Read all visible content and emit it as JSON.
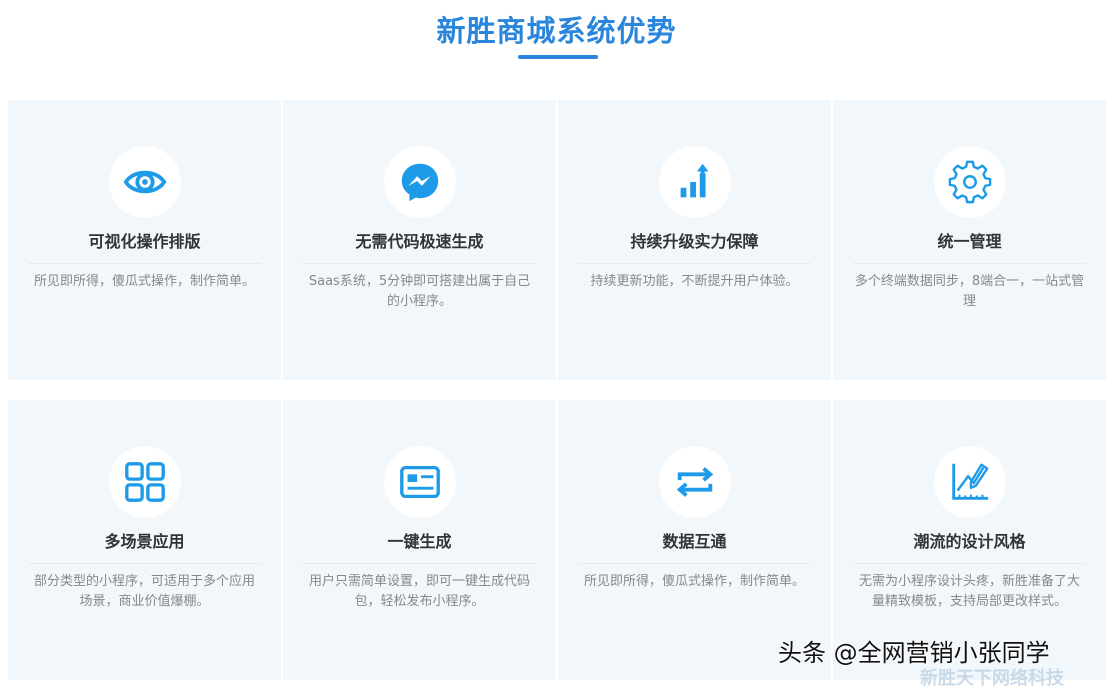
{
  "header": {
    "title": "新胜商城系统优势"
  },
  "accent_color": "#2a86dc",
  "icon_color": "#1e9be8",
  "cards": [
    {
      "icon": "eye-icon",
      "title": "可视化操作排版",
      "desc": "所见即所得，傻瓜式操作，制作简单。"
    },
    {
      "icon": "messenger-icon",
      "title": "无需代码极速生成",
      "desc": "Saas系统，5分钟即可搭建出属于自己的小程序。"
    },
    {
      "icon": "bar-chart-up-icon",
      "title": "持续升级实力保障",
      "desc": "持续更新功能，不断提升用户体验。"
    },
    {
      "icon": "gear-icon",
      "title": "统一管理",
      "desc": "多个终端数据同步，8端合一，一站式管理"
    },
    {
      "icon": "grid-apps-icon",
      "title": "多场景应用",
      "desc": "部分类型的小程序，可适用于多个应用场景，商业价值爆棚。"
    },
    {
      "icon": "id-card-icon",
      "title": "一键生成",
      "desc": "用户只需简单设置，即可一键生成代码包，轻松发布小程序。"
    },
    {
      "icon": "sync-arrows-icon",
      "title": "数据互通",
      "desc": "所见即所得，傻瓜式操作，制作简单。"
    },
    {
      "icon": "design-ruler-pen-icon",
      "title": "潮流的设计风格",
      "desc": "无需为小程序设计头疼，新胜准备了大量精致模板，支持局部更改样式。"
    }
  ],
  "watermark": {
    "text": "头条 @全网营销小张同学",
    "sub_text": "新胜天下网络科技"
  }
}
